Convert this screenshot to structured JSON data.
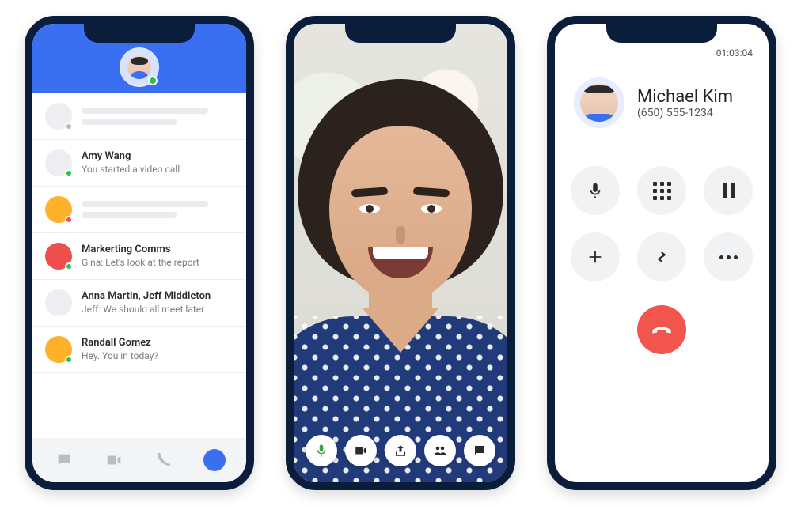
{
  "phoneA": {
    "header_user_presence": "green",
    "rows": [
      {
        "kind": "skeleton",
        "avatar_color": "gray",
        "presence": "grey"
      },
      {
        "kind": "chat",
        "avatar_color": "gray",
        "presence": "green",
        "title": "Amy Wang",
        "subtitle": "You started a video call"
      },
      {
        "kind": "skeleton",
        "avatar_color": "orange",
        "presence": "red"
      },
      {
        "kind": "chat",
        "avatar_color": "red",
        "presence": "green",
        "title": "Markerting Comms",
        "subtitle": "Gina: Let's look at the report"
      },
      {
        "kind": "chat",
        "avatar_color": "gray",
        "presence": "none",
        "title": "Anna Martin, Jeff Middleton",
        "subtitle": "Jeff: We should all meet later"
      },
      {
        "kind": "chat",
        "avatar_color": "orange",
        "presence": "green",
        "title": "Randall Gomez",
        "subtitle": "Hey. You in today?"
      }
    ],
    "tabs": {
      "chat": "chat-icon",
      "video": "video-icon",
      "phone": "phone-icon",
      "profile": "profile-icon"
    }
  },
  "phoneB": {
    "controls": {
      "mic": "mic-icon",
      "camera": "camera-icon",
      "share": "share-icon",
      "participants": "participants-icon",
      "chat": "chat-icon"
    }
  },
  "phoneC": {
    "duration": "01:03:04",
    "contact_name": "Michael Kim",
    "contact_phone": "(650) 555-1234",
    "buttons": {
      "mute": "mic-icon",
      "dialpad": "dialpad-icon",
      "hold": "pause-icon",
      "add": "plus-icon",
      "transfer": "transfer-icon",
      "more": "more-icon"
    },
    "end": "end-call-icon"
  },
  "colors": {
    "brand_blue": "#3b6ff2",
    "end_red": "#f1554d",
    "presence_green": "#2fbf4e",
    "presence_red": "#f04d4d"
  }
}
